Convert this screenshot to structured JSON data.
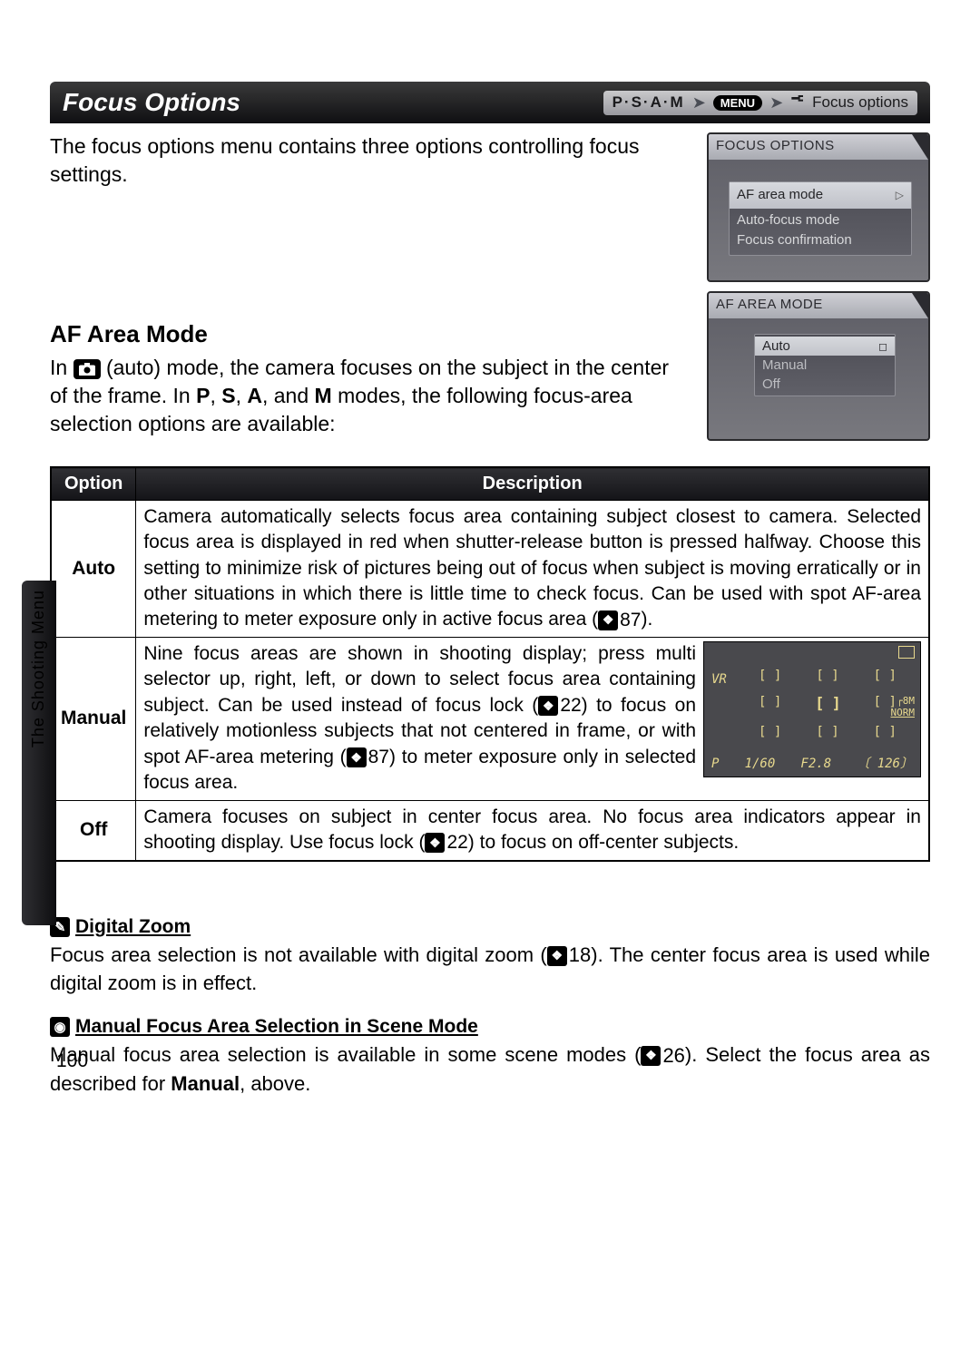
{
  "titlebar": {
    "title": "Focus Options",
    "psam": "P·S·A·M",
    "menu_pill": "MENU",
    "crumb": "Focus options"
  },
  "intro": "The focus options menu contains three options controlling focus settings.",
  "panel_focus": {
    "header": "FOCUS OPTIONS",
    "items": [
      "AF area mode",
      "Auto-focus mode",
      "Focus confirmation"
    ],
    "selected_index": 0
  },
  "af_area": {
    "heading": "AF Area Mode",
    "body_pre": "In ",
    "body_auto": " (auto) mode, the camera focuses on the subject in the center of the frame.  In ",
    "modes": [
      "P",
      "S",
      "A",
      "M"
    ],
    "body_post": " modes, the following focus-area selection options are available:"
  },
  "panel_afarea": {
    "header": "AF AREA MODE",
    "items": [
      "Auto",
      "Manual",
      "Off"
    ],
    "selected_index": 0
  },
  "table": {
    "col_option": "Option",
    "col_desc": "Description",
    "rows": [
      {
        "option": "Auto",
        "desc": "Camera automatically selects focus area containing subject closest to camera.  Selected focus area is displayed in red when shutter-release button is pressed halfway.  Choose this setting to minimize risk of pictures being out of focus when subject is moving erratically or in other situations in which there is little time to check focus.  Can be used with spot AF-area metering to meter exposure only in active focus area (",
        "ref": "87",
        "desc_tail": ")."
      },
      {
        "option": "Manual",
        "desc_a": "Nine focus areas are shown in shooting display; press multi selector up, right, left, or down to select focus area containing subject.  Can be used instead of focus lock (",
        "ref_a": "22",
        "desc_b": ") to focus on relatively motionless subjects that not centered in frame, or with spot AF-area metering (",
        "ref_b": "87",
        "desc_c": ") to meter exposure only in selected focus area.",
        "thumb": {
          "vr": "VR",
          "p": "P",
          "shutter": "1/60",
          "f": "F2.8",
          "count": "126",
          "size": "8M",
          "qual": "NORM"
        }
      },
      {
        "option": "Off",
        "desc_a": "Camera focuses on subject in center focus area.  No focus area indicators appear in shooting display.  Use focus lock (",
        "ref": "22",
        "desc_b": ") to focus on off-center subjects."
      }
    ]
  },
  "notes": {
    "digital_zoom": {
      "title": "Digital Zoom",
      "body_a": "Focus area selection is not available with digital zoom (",
      "ref": "18",
      "body_b": ").  The center focus area is used while digital zoom is in effect."
    },
    "manual_scene": {
      "title": "Manual Focus Area Selection in Scene Mode",
      "body_a": "Manual focus area selection is available in some scene modes (",
      "ref": "26",
      "body_b": ").  Select the focus area as described for ",
      "bold": "Manual",
      "body_c": ", above."
    }
  },
  "sidebar": "The Shooting Menu",
  "page_number": "100"
}
